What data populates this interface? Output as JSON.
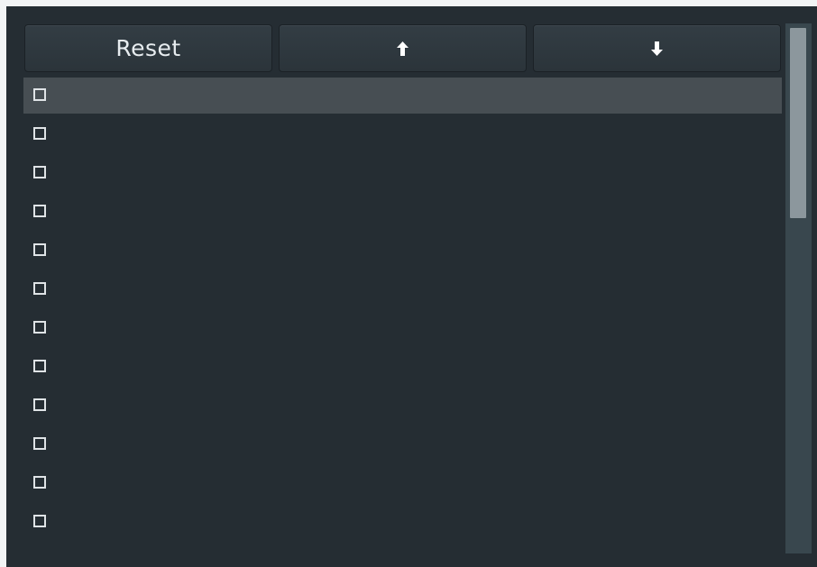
{
  "toolbar": {
    "reset_label": "Reset",
    "up_icon": "arrow-up-icon",
    "down_icon": "arrow-down-icon"
  },
  "list": {
    "selected_index": 0,
    "items": [
      {
        "label": "",
        "checked": false
      },
      {
        "label": "",
        "checked": false
      },
      {
        "label": "",
        "checked": false
      },
      {
        "label": "",
        "checked": false
      },
      {
        "label": "",
        "checked": false
      },
      {
        "label": "",
        "checked": false
      },
      {
        "label": "",
        "checked": false
      },
      {
        "label": "",
        "checked": false
      },
      {
        "label": "",
        "checked": false
      },
      {
        "label": "",
        "checked": false
      },
      {
        "label": "",
        "checked": false
      },
      {
        "label": "",
        "checked": false
      }
    ]
  },
  "colors": {
    "panel_bg": "#252d33",
    "selected_row": "#474e53",
    "scrollbar_track": "#39474e",
    "scrollbar_thumb": "#8c979d",
    "text": "#e7ecef"
  }
}
